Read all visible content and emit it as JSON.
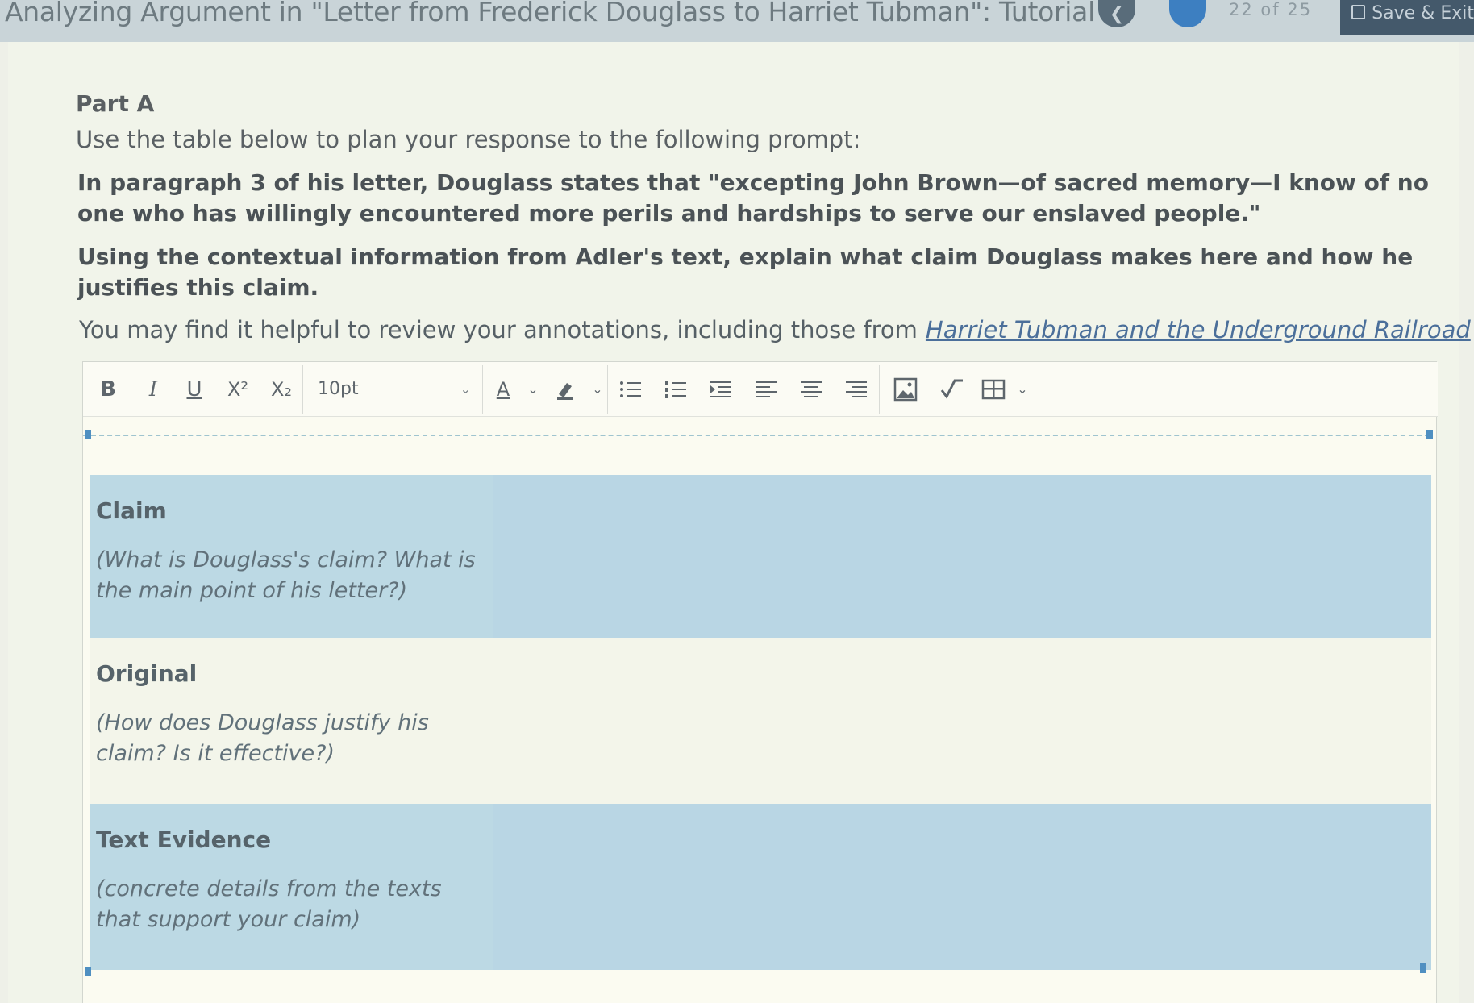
{
  "header": {
    "title": "Analyzing Argument in \"Letter from Frederick Douglass to Harriet Tubman\": Tutorial",
    "page_current": "22",
    "page_of": "of",
    "page_total": "25",
    "save_exit_label": "Save & Exit"
  },
  "content": {
    "part_label": "Part A",
    "intro": "Use the table below to plan your response to the following prompt:",
    "prompt_line1": "In paragraph 3 of his letter, Douglass states that \"excepting John Brown—of sacred memory—I know of no one who has willingly encountered more perils and hardships to serve our enslaved people.\"",
    "prompt_line2": "Using the contextual information from Adler's text, explain what claim Douglass makes here and how he justifies this claim.",
    "hint_text": "You may find it helpful to review your annotations, including those from",
    "hint_link": "Harriet Tubman and the Underground Railroad",
    "hint_end": "."
  },
  "toolbar": {
    "bold": "B",
    "italic": "I",
    "underline": "U",
    "superscript": "X²",
    "subscript": "X₂",
    "font_size": "10pt",
    "font_color": "A",
    "icons": [
      "bold-icon",
      "italic-icon",
      "underline-icon",
      "superscript-icon",
      "subscript-icon",
      "font-color-icon",
      "highlight-icon",
      "bullet-list-icon",
      "numbered-list-icon",
      "indent-icon",
      "align-left-icon",
      "align-center-icon",
      "align-right-icon",
      "image-icon",
      "equation-icon",
      "table-icon"
    ]
  },
  "table": {
    "rows": [
      {
        "heading": "Claim",
        "sub": "(What is Douglass's claim? What is the main point of his letter?)"
      },
      {
        "heading": "Original",
        "sub": "(How does Douglass justify his claim? Is it effective?)"
      },
      {
        "heading": "Text Evidence",
        "sub": "(concrete details from the texts that support your claim)"
      }
    ]
  },
  "colors": {
    "header_bg": "#c9d4d8",
    "save_bg": "#44596b",
    "next_btn": "#3d7fc1",
    "row_blue": "#bcd9e4",
    "link": "#4b6f9a"
  }
}
